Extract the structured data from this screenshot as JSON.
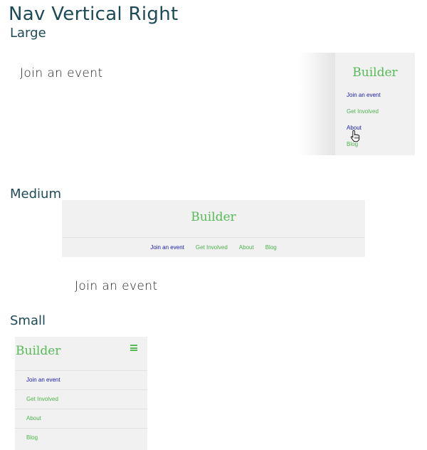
{
  "page_title": "Nav Vertical Right",
  "sections": {
    "large": {
      "label": "Large",
      "heading": "Join an event",
      "brand": "Builder",
      "nav": [
        {
          "label": "Join an event",
          "color": "#1a1ab0"
        },
        {
          "label": "Get Involved",
          "color": "#4cb44c"
        },
        {
          "label": "About",
          "color": "#1a1ab0"
        },
        {
          "label": "Blog",
          "color": "#4cb44c"
        }
      ]
    },
    "medium": {
      "label": "Medium",
      "brand": "Builder",
      "nav": [
        {
          "label": "Join an event",
          "color": "#1a1ab0"
        },
        {
          "label": "Get Involved",
          "color": "#4cb44c"
        },
        {
          "label": "About",
          "color": "#4cb44c"
        },
        {
          "label": "Blog",
          "color": "#4cb44c"
        }
      ],
      "heading": "Join an event"
    },
    "small": {
      "label": "Small",
      "brand": "Builder",
      "menu_icon": "hamburger-icon",
      "nav": [
        {
          "label": "Join an event",
          "color": "#1a1ab0"
        },
        {
          "label": "Get Involved",
          "color": "#4cb44c"
        },
        {
          "label": "About",
          "color": "#4cb44c"
        },
        {
          "label": "Blog",
          "color": "#4cb44c"
        }
      ]
    }
  },
  "colors": {
    "title": "#1d4a57",
    "brand": "#55bb55",
    "panel": "#f1f1f1"
  }
}
